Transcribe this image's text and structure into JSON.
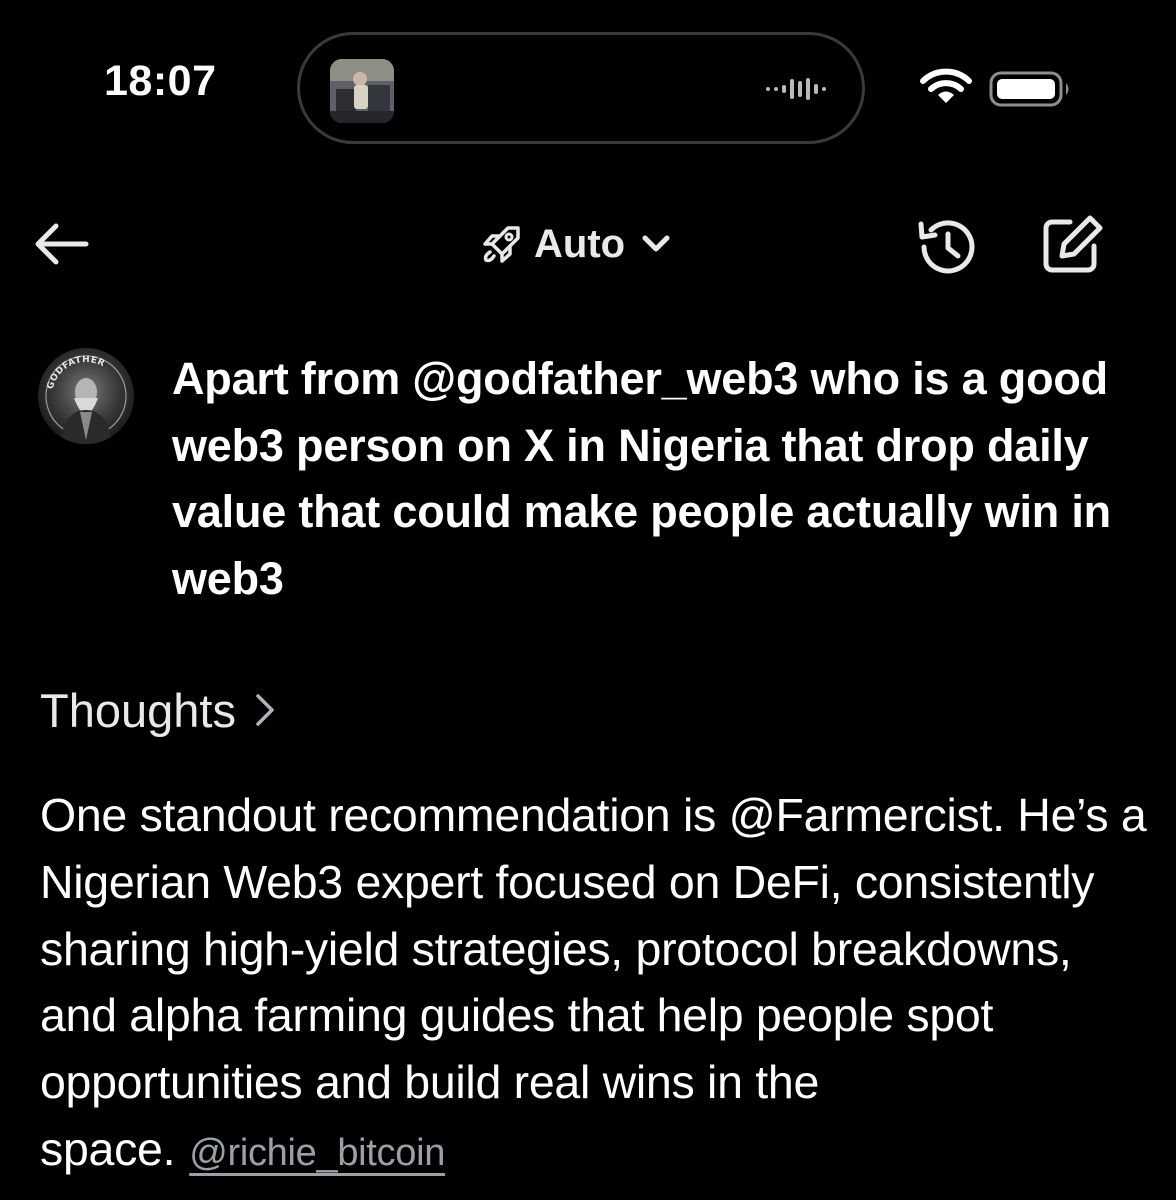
{
  "status_bar": {
    "time": "18:07",
    "icons": [
      "photo-thumbnail-icon",
      "waveform-icon",
      "wifi-icon",
      "battery-icon"
    ]
  },
  "nav": {
    "mode_label": "Auto",
    "icons": [
      "back-arrow-icon",
      "rocket-icon",
      "chevron-down-icon",
      "history-icon",
      "new-chat-icon"
    ]
  },
  "conversation": {
    "avatar_text": "GODFATHER",
    "user_message": "Apart from @godfather_web3 who is a good web3 person on X in Nigeria that drop daily value that could make people actually win in web3",
    "thoughts_label": "Thoughts",
    "response_text": "One standout recommendation is @Farmercist. He’s a Nigerian Web3 expert focused on DeFi, consistently sharing high-yield strategies, protocol breakdowns, and alpha farming guides that help people spot opportunities and build real wins in the space.",
    "response_handle": "@richie_bitcoin"
  },
  "colors": {
    "background": "#000000",
    "text_primary": "#ffffff",
    "text_secondary": "#e7e9ea",
    "handle": "#9aa0a6",
    "island_border": "#3a3a3c"
  }
}
